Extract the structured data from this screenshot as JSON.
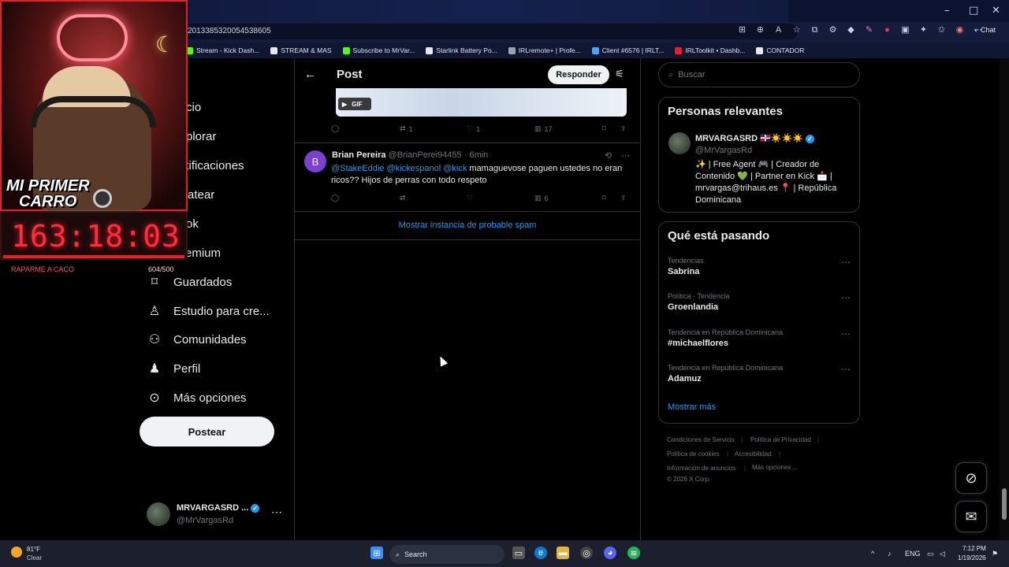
{
  "browser": {
    "url": "2013385320054538605",
    "window_controls": {
      "minimize": "–",
      "maximize": "□",
      "close": "✕"
    },
    "copilot_label": "Chat",
    "bookmarks": [
      {
        "label": "Stream - Kick Dash...",
        "color": "#53fc18"
      },
      {
        "label": "STREAM & MAS",
        "color": "#e7e9ea"
      },
      {
        "label": "Subscribe to MrVar...",
        "color": "#53fc18"
      },
      {
        "label": "Starlink Battery Po...",
        "color": "#e7e9ea"
      },
      {
        "label": "IRLremote+ | Profe...",
        "color": "#9aa3b2"
      },
      {
        "label": "Client #6576 | IRLT...",
        "color": "#4aa3ff"
      },
      {
        "label": "IRLToolkit • Dashb...",
        "color": "#e0222c"
      },
      {
        "label": "CONTADOR",
        "color": "#e7e9ea"
      }
    ]
  },
  "stream_overlay": {
    "line1": "MI PRIMER",
    "line2": "CARRO",
    "timer": "163:18:03",
    "goal_label": "RAPARME A CACO",
    "goal_count": "604/500"
  },
  "nav": {
    "partial_items": [
      {
        "label": "cio"
      },
      {
        "label": "plorar"
      },
      {
        "label": "otificaciones"
      },
      {
        "label": "atear"
      },
      {
        "label": "ok"
      },
      {
        "label": "emium"
      }
    ],
    "items": [
      {
        "label": "Guardados",
        "icon": "bookmark-icon"
      },
      {
        "label": "Estudio para cre...",
        "icon": "studio-icon"
      },
      {
        "label": "Comunidades",
        "icon": "communities-icon"
      },
      {
        "label": "Perfil",
        "icon": "profile-icon"
      },
      {
        "label": "Más opciones",
        "icon": "more-options-icon"
      }
    ],
    "post_button": "Postear",
    "account": {
      "name": "MRVARGASRD ...",
      "handle": "@MrVargasRd"
    }
  },
  "center": {
    "title": "Post",
    "reply_button": "Responder",
    "gif_label": "GIF",
    "first_post_actions": {
      "reposts": "1",
      "likes": "1",
      "views": "17"
    },
    "reply_tweet": {
      "avatar_letter": "B",
      "name": "Brian Pereira",
      "handle": "@BrianPerei94455",
      "time": "· 6min",
      "mention1": "@StakeEddie",
      "mention2": "@kickespanol",
      "mention3": "@kick",
      "text_after": " mamaguevose paguen ustedes no eran",
      "text_line2": "ricos?? Hijos de perras con todo respeto",
      "views": "6"
    },
    "spam_link": "Mostrar instancia de probable spam"
  },
  "right": {
    "search_placeholder": "Buscar",
    "relevant": {
      "title": "Personas relevantes",
      "name": "MRVARGASRD 🇩🇴☀️☀️☀️",
      "handle": "@MrVargasRd",
      "bio": "✨ | Free Agent 🎮 | Creador de Contenido 💚 | Partner en Kick 📩 | mrvargas@trihaus.es 📍 | República Dominicana"
    },
    "trends": {
      "title": "Qué está pasando",
      "items": [
        {
          "category": "Tendencias",
          "name": "Sabrina"
        },
        {
          "category": "Política · Tendencia",
          "name": "Groenlandia"
        },
        {
          "category": "Tendencia en República Dominicana",
          "name": "#michaelflores"
        },
        {
          "category": "Tendencia en República Dominicana",
          "name": "Adamuz"
        }
      ],
      "show_more": "Mostrar más"
    },
    "footer": {
      "terms": "Condiciones de Servicio",
      "privacy": "Política de Privacidad",
      "cookies": "Política de cookies",
      "accessibility": "Accesibilidad",
      "ads": "Información de anuncios",
      "more": "Más opciones ...",
      "copyright": "© 2026 X Corp."
    }
  },
  "taskbar": {
    "weather_temp": "81°F",
    "weather_desc": "Clear",
    "search_label": "Search",
    "lang": "ENG",
    "time": "7:12 PM",
    "date": "1/19/2026"
  }
}
